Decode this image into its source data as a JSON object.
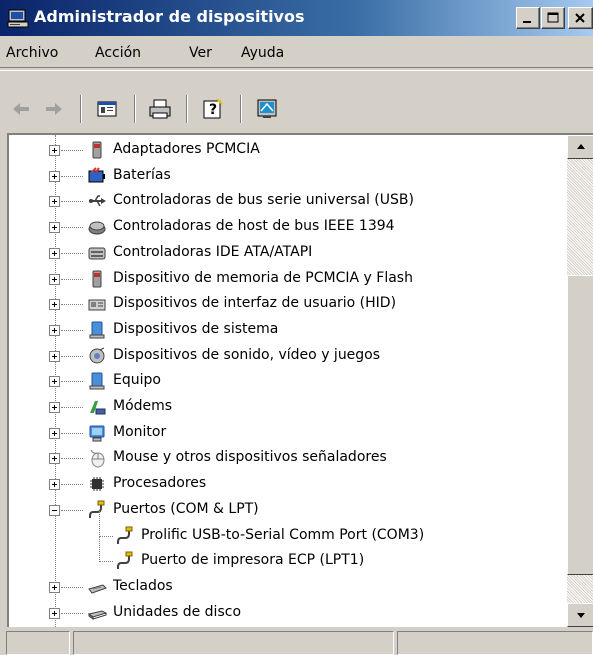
{
  "window": {
    "title": "Administrador de dispositivos",
    "title_color": "#ffffff",
    "titlebar_gradient": [
      "#0a246a",
      "#a6caf0"
    ]
  },
  "menu": {
    "items": [
      "Archivo",
      "Acción",
      "Ver",
      "Ayuda"
    ]
  },
  "toolbar": {
    "buttons": [
      {
        "name": "back-arrow-icon",
        "enabled": false
      },
      {
        "name": "forward-arrow-icon",
        "enabled": false
      },
      {
        "name": "properties-icon",
        "enabled": true
      },
      {
        "name": "print-icon",
        "enabled": true
      },
      {
        "name": "help-icon",
        "enabled": true
      },
      {
        "name": "scan-hardware-icon",
        "enabled": true
      }
    ]
  },
  "tree": {
    "items": [
      {
        "label": "Adaptadores PCMCIA",
        "icon": "pcmcia-icon",
        "level": 1,
        "expander": "plus"
      },
      {
        "label": "Baterías",
        "icon": "battery-icon",
        "level": 1,
        "expander": "plus"
      },
      {
        "label": "Controladoras de bus serie universal (USB)",
        "icon": "usb-icon",
        "level": 1,
        "expander": "plus"
      },
      {
        "label": "Controladoras de host de bus IEEE 1394",
        "icon": "ieee1394-icon",
        "level": 1,
        "expander": "plus"
      },
      {
        "label": "Controladoras IDE ATA/ATAPI",
        "icon": "ide-controller-icon",
        "level": 1,
        "expander": "plus"
      },
      {
        "label": "Dispositivo de memoria de PCMCIA y Flash",
        "icon": "pcmcia-memory-icon",
        "level": 1,
        "expander": "plus"
      },
      {
        "label": "Dispositivos de interfaz de usuario (HID)",
        "icon": "hid-icon",
        "level": 1,
        "expander": "plus"
      },
      {
        "label": "Dispositivos de sistema",
        "icon": "system-device-icon",
        "level": 1,
        "expander": "plus"
      },
      {
        "label": "Dispositivos de sonido, vídeo y juegos",
        "icon": "sound-icon",
        "level": 1,
        "expander": "plus"
      },
      {
        "label": "Equipo",
        "icon": "computer-icon",
        "level": 1,
        "expander": "plus"
      },
      {
        "label": "Módems",
        "icon": "modem-icon",
        "level": 1,
        "expander": "plus"
      },
      {
        "label": "Monitor",
        "icon": "monitor-icon",
        "level": 1,
        "expander": "plus"
      },
      {
        "label": "Mouse y otros dispositivos señaladores",
        "icon": "mouse-icon",
        "level": 1,
        "expander": "plus"
      },
      {
        "label": "Procesadores",
        "icon": "processor-icon",
        "level": 1,
        "expander": "plus"
      },
      {
        "label": "Puertos (COM & LPT)",
        "icon": "port-icon",
        "level": 1,
        "expander": "minus"
      },
      {
        "label": "Prolific USB-to-Serial Comm Port (COM3)",
        "icon": "port-icon",
        "level": 2,
        "expander": "none"
      },
      {
        "label": "Puerto de impresora ECP (LPT1)",
        "icon": "port-icon",
        "level": 2,
        "expander": "none"
      },
      {
        "label": "Teclados",
        "icon": "keyboard-icon",
        "level": 1,
        "expander": "plus"
      },
      {
        "label": "Unidades de disco",
        "icon": "disk-drive-icon",
        "level": 1,
        "expander": "plus"
      }
    ]
  },
  "statusbar": {
    "panes": [
      "",
      "",
      ""
    ]
  }
}
